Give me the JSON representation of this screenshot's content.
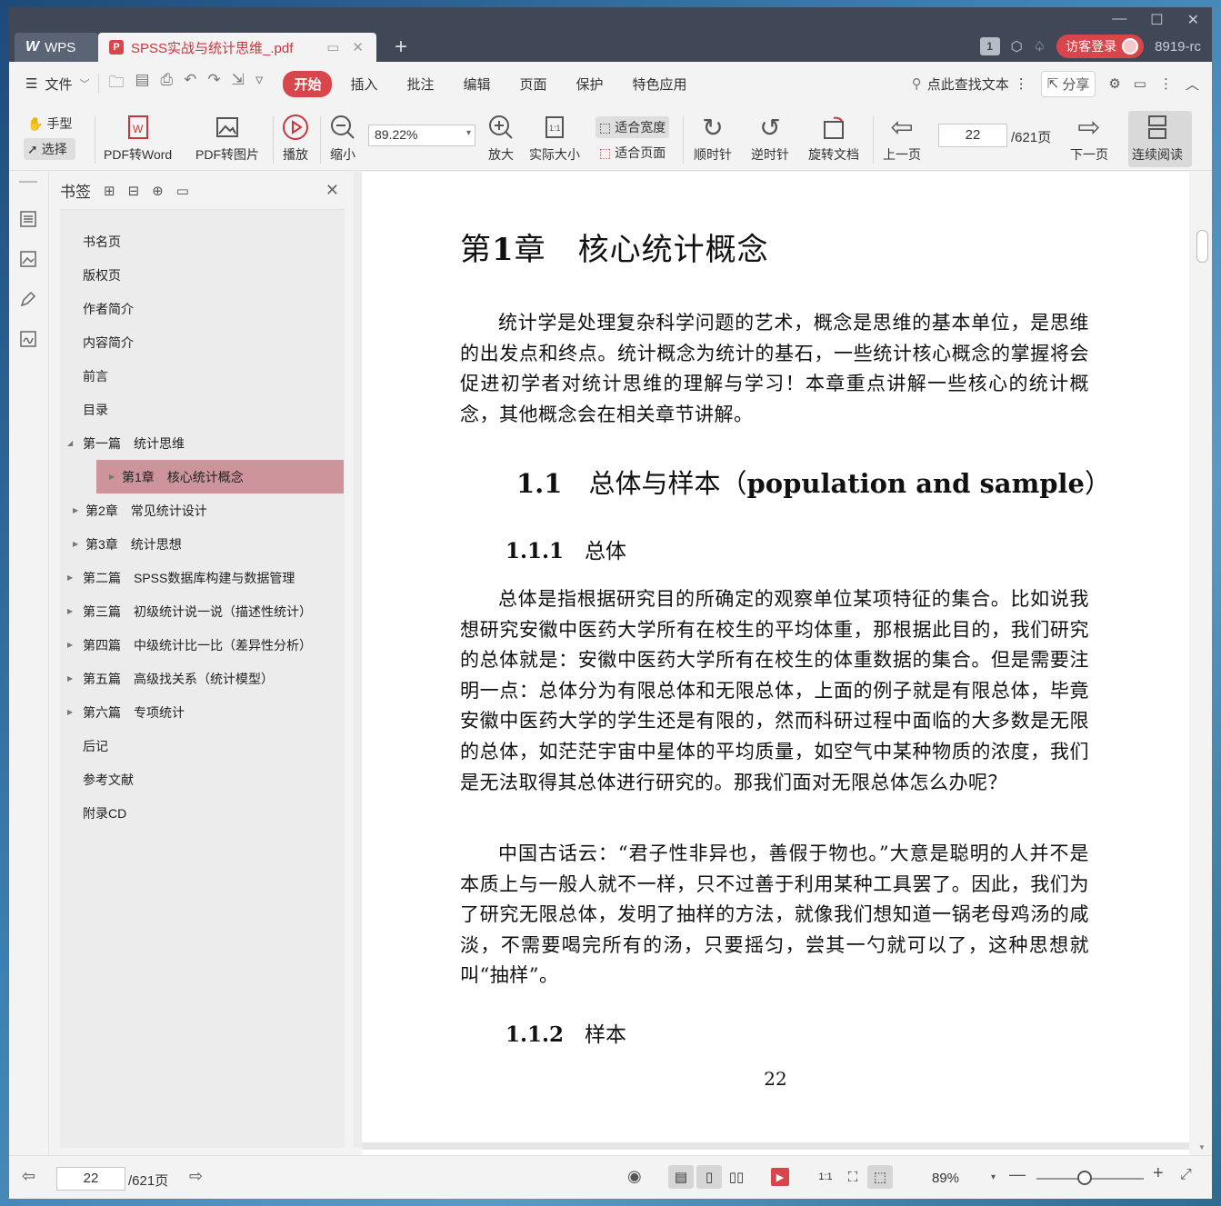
{
  "titlebar": {
    "app_tab": "WPS",
    "app_logo": "W",
    "doc_tab": "SPSS实战与统计思维_.pdf",
    "pdf_badge": "P",
    "count_badge": "1",
    "login_label": "访客登录",
    "user_label": "8919-rc"
  },
  "menu": {
    "file_label": "文件",
    "tabs": [
      "开始",
      "插入",
      "批注",
      "编辑",
      "页面",
      "保护",
      "特色应用"
    ],
    "search_label": "点此查找文本",
    "share_label": "分享"
  },
  "ribbon": {
    "hand_label": "手型",
    "select_label": "选择",
    "pdf2word": "PDF转Word",
    "pdf2img": "PDF转图片",
    "play": "播放",
    "zoom_out": "缩小",
    "zoom_value": "89.22%",
    "zoom_in": "放大",
    "actual_size": "实际大小",
    "fit_width": "适合宽度",
    "fit_page": "适合页面",
    "clockwise": "顺时针",
    "counterclockwise": "逆时针",
    "rotate_doc": "旋转文档",
    "prev_page": "上一页",
    "page_value": "22",
    "page_total": "/621页",
    "next_page": "下一页",
    "continuous": "连续阅读"
  },
  "bookmarks": {
    "title": "书签",
    "items": [
      {
        "label": "书名页",
        "level": 0,
        "arrow": ""
      },
      {
        "label": "版权页",
        "level": 0,
        "arrow": ""
      },
      {
        "label": "作者简介",
        "level": 0,
        "arrow": ""
      },
      {
        "label": "内容简介",
        "level": 0,
        "arrow": ""
      },
      {
        "label": "前言",
        "level": 0,
        "arrow": ""
      },
      {
        "label": "目录",
        "level": 0,
        "arrow": ""
      },
      {
        "label": "第一篇　统计思维",
        "level": 0,
        "arrow": "◢"
      },
      {
        "label": "第1章　核心统计概念",
        "level": 1,
        "arrow": "▶",
        "active": true
      },
      {
        "label": "第2章　常见统计设计",
        "level": 1,
        "arrow": "▶"
      },
      {
        "label": "第3章　统计思想",
        "level": 1,
        "arrow": "▶"
      },
      {
        "label": "第二篇　SPSS数据库构建与数据管理",
        "level": 0,
        "arrow": "▶"
      },
      {
        "label": "第三篇　初级统计说一说（描述性统计）",
        "level": 0,
        "arrow": "▶"
      },
      {
        "label": "第四篇　中级统计比一比（差异性分析）",
        "level": 0,
        "arrow": "▶"
      },
      {
        "label": "第五篇　高级找关系（统计模型）",
        "level": 0,
        "arrow": "▶"
      },
      {
        "label": "第六篇　专项统计",
        "level": 0,
        "arrow": "▶"
      },
      {
        "label": "后记",
        "level": 0,
        "arrow": ""
      },
      {
        "label": "参考文献",
        "level": 0,
        "arrow": ""
      },
      {
        "label": "附录CD",
        "level": 0,
        "arrow": ""
      }
    ]
  },
  "document": {
    "chapter_num": "1",
    "chapter_prefix": "第",
    "chapter_suffix": "章　核心统计概念",
    "intro": "统计学是处理复杂科学问题的艺术，概念是思维的基本单位，是思维的出发点和终点。统计概念为统计的基石，一些统计核心概念的掌握将会促进初学者对统计思维的理解与学习！本章重点讲解一些核心的统计概念，其他概念会在相关章节讲解。",
    "section_num": "1.1",
    "section_title": "总体与样本（",
    "section_title_en": "population and sample",
    "section_title_end": "）",
    "sub1_num": "1.1.1",
    "sub1_title": "总体",
    "para1": "总体是指根据研究目的所确定的观察单位某项特征的集合。比如说我想研究安徽中医药大学所有在校生的平均体重，那根据此目的，我们研究的总体就是：安徽中医药大学所有在校生的体重数据的集合。但是需要注明一点：总体分为有限总体和无限总体，上面的例子就是有限总体，毕竟安徽中医药大学的学生还是有限的，然而科研过程中面临的大多数是无限的总体，如茫茫宇宙中星体的平均质量，如空气中某种物质的浓度，我们是无法取得其总体进行研究的。那我们面对无限总体怎么办呢？",
    "para2": "中国古话云：“君子性非异也，善假于物也。”大意是聪明的人并不是本质上与一般人就不一样，只不过善于利用某种工具罢了。因此，我们为了研究无限总体，发明了抽样的方法，就像我们想知道一锅老母鸡汤的咸淡，不需要喝完所有的汤，只要摇匀，尝其一勺就可以了，这种思想就叫“抽样”。",
    "sub2_num": "1.1.2",
    "sub2_title": "样本",
    "page_number": "22"
  },
  "statusbar": {
    "page_value": "22",
    "page_total": "/621页",
    "zoom_pct": "89%",
    "zoom_level": 0.45
  },
  "colors": {
    "accent": "#d8454a",
    "titlebar": "#404857",
    "bookmark_active": "#cd959b"
  }
}
